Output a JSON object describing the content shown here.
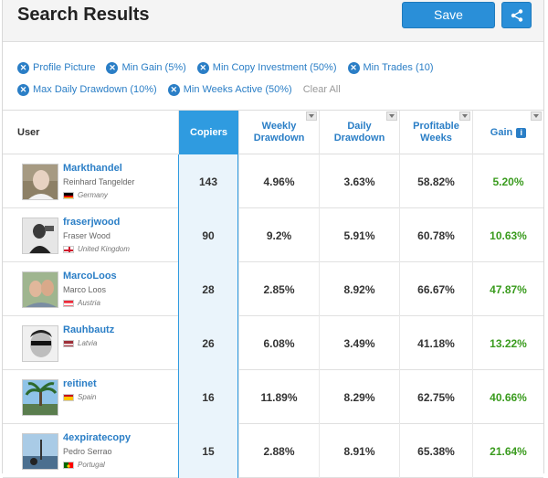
{
  "header": {
    "title": "Search Results",
    "save_label": "Save"
  },
  "filters": {
    "row1": [
      "Profile Picture",
      "Min Gain (5%)",
      "Min Copy Investment (50%)",
      "Min Trades (10)"
    ],
    "row2": [
      "Max Daily Drawdown (10%)",
      "Min Weeks Active (50%)"
    ],
    "clear_all": "Clear All"
  },
  "columns": {
    "user": "User",
    "copiers": "Copiers",
    "weekly_drawdown": "Weekly Drawdown",
    "daily_drawdown": "Daily Drawdown",
    "profitable_weeks": "Profitable Weeks",
    "gain": "Gain"
  },
  "rows": [
    {
      "username": "Markthandel",
      "realname": "Reinhard Tangelder",
      "country": "Germany",
      "copiers": "143",
      "weekly": "4.96%",
      "daily": "3.63%",
      "profitable": "58.82%",
      "gain": "5.20%"
    },
    {
      "username": "fraserjwood",
      "realname": "Fraser Wood",
      "country": "United Kingdom",
      "copiers": "90",
      "weekly": "9.2%",
      "daily": "5.91%",
      "profitable": "60.78%",
      "gain": "10.63%"
    },
    {
      "username": "MarcoLoos",
      "realname": "Marco Loos",
      "country": "Austria",
      "copiers": "28",
      "weekly": "2.85%",
      "daily": "8.92%",
      "profitable": "66.67%",
      "gain": "47.87%"
    },
    {
      "username": "Rauhbautz",
      "realname": "",
      "country": "Latvia",
      "copiers": "26",
      "weekly": "6.08%",
      "daily": "3.49%",
      "profitable": "41.18%",
      "gain": "13.22%"
    },
    {
      "username": "reitinet",
      "realname": "",
      "country": "Spain",
      "copiers": "16",
      "weekly": "11.89%",
      "daily": "8.29%",
      "profitable": "62.75%",
      "gain": "40.66%"
    },
    {
      "username": "4expiratecopy",
      "realname": "Pedro Serrao",
      "country": "Portugal",
      "copiers": "15",
      "weekly": "2.88%",
      "daily": "8.91%",
      "profitable": "65.38%",
      "gain": "21.64%"
    }
  ],
  "colors": {
    "accent": "#2a7ec6",
    "button": "#2a8fd8",
    "gain": "#3a9b1e",
    "active_column": "#2f9be0"
  }
}
